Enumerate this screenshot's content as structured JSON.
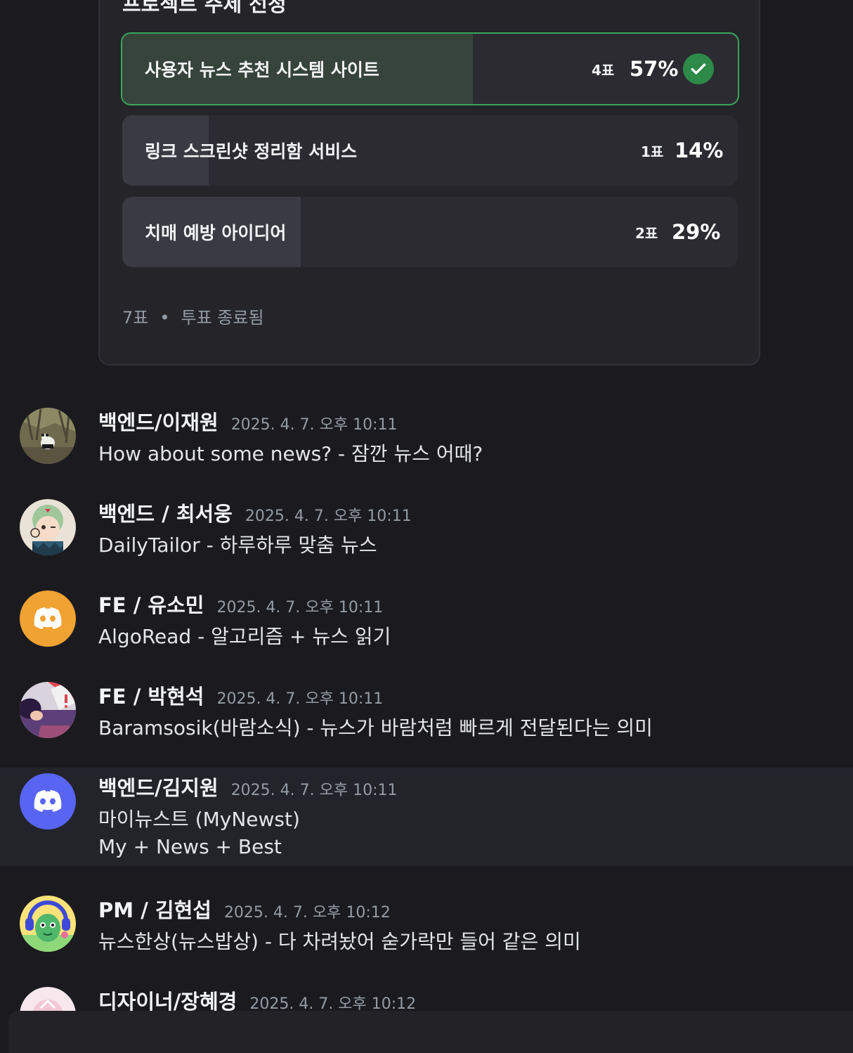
{
  "poll": {
    "question": "프로젝트 주제 선정",
    "options": [
      {
        "label": "사용자 뉴스 추천 시스템 사이트",
        "votes": "4표",
        "percent": "57%",
        "fraction": 0.57,
        "winner": true
      },
      {
        "label": "링크 스크린샷 정리함 서비스",
        "votes": "1표",
        "percent": "14%",
        "fraction": 0.14,
        "winner": false
      },
      {
        "label": "치매 예방 아이디어",
        "votes": "2표",
        "percent": "29%",
        "fraction": 0.29,
        "winner": false
      }
    ],
    "total_votes": "7표",
    "separator": "•",
    "status": "투표 종료됨"
  },
  "messages": [
    {
      "author": "백엔드/이재원",
      "timestamp": "2025. 4. 7. 오후 10:11",
      "lines": [
        "How about some news? - 잠깐 뉴스 어때?"
      ],
      "avatar": "panda-photo"
    },
    {
      "author": "백엔드 / 최서웅",
      "timestamp": "2025. 4. 7. 오후 10:11",
      "lines": [
        "DailyTailor - 하루하루 맞춤 뉴스"
      ],
      "avatar": "illustrated-character"
    },
    {
      "author": "FE / 유소민",
      "timestamp": "2025. 4. 7. 오후 10:11",
      "lines": [
        "AlgoRead - 알고리즘 + 뉴스 읽기"
      ],
      "avatar": "discord-default-orange",
      "color": "#f0a232"
    },
    {
      "author": "FE / 박현석",
      "timestamp": "2025. 4. 7. 오후 10:11",
      "lines": [
        "Baramsosik(바람소식) - 뉴스가 바람처럼 빠르게 전달된다는 의미"
      ],
      "avatar": "anime-character"
    },
    {
      "author": "백엔드/김지원",
      "timestamp": "2025. 4. 7. 오후 10:11",
      "lines": [
        "마이뉴스트 (MyNewst)",
        "My + News + Best"
      ],
      "avatar": "discord-default-blurple",
      "color": "#5865f2"
    },
    {
      "author": "PM / 김현섭",
      "timestamp": "2025. 4. 7. 오후 10:12",
      "lines": [
        "뉴스한상(뉴스밥상) - 다 차려놨어 숟가락만 들어 같은 의미"
      ],
      "avatar": "green-character"
    },
    {
      "author": "디자이너/장혜경",
      "timestamp": "2025. 4. 7. 오후 10:12",
      "lines": [],
      "avatar": "pink-character"
    }
  ],
  "colors": {
    "background": "#1b1b1f",
    "card": "#242429",
    "winner_border": "#3ba55c",
    "check": "#2d8a48"
  }
}
